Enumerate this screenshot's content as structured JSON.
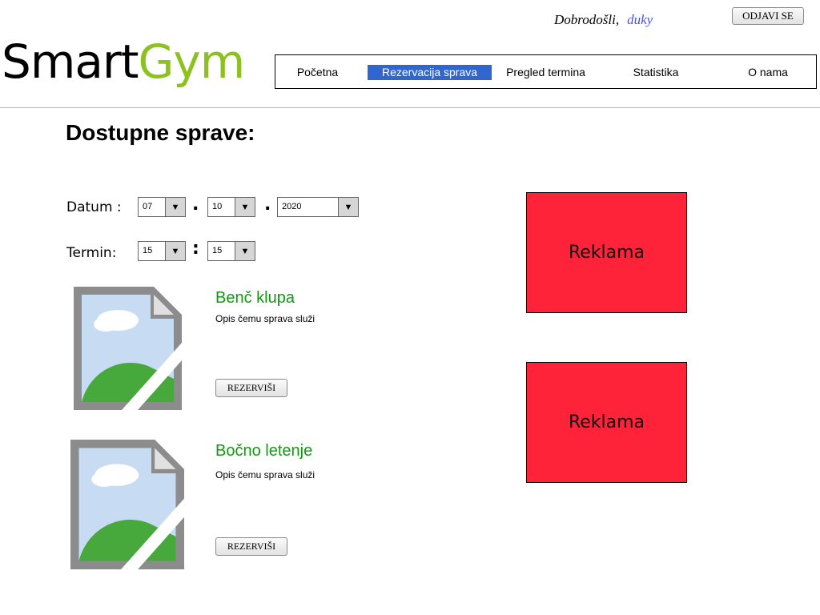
{
  "header": {
    "welcome_text": "Dobrodošli,",
    "username": "duky",
    "logout_label": "ODJAVI SE",
    "logo_part1": "Smart",
    "logo_part2": "Gym"
  },
  "nav": {
    "items": [
      {
        "label": "Početna",
        "active": false
      },
      {
        "label": "Rezervacija sprava",
        "active": true
      },
      {
        "label": "Pregled termina",
        "active": false
      },
      {
        "label": "Statistika",
        "active": false
      },
      {
        "label": "O nama",
        "active": false
      }
    ]
  },
  "main": {
    "title": "Dostupne sprave:",
    "date_label": "Datum :",
    "date_separator": ".",
    "day": "07",
    "month": "10",
    "year": "2020",
    "time_label": "Termin:",
    "time_separator": ":",
    "hour": "15",
    "minute": "15",
    "equipment": [
      {
        "name": "Benč klupa",
        "description": "Opis čemu sprava služi",
        "button": "REZERVIŠI"
      },
      {
        "name": "Bočno letenje",
        "description": "Opis čemu sprava služi",
        "button": "REZERVIŠI"
      }
    ]
  },
  "ads": [
    "Reklama",
    "Reklama"
  ],
  "colors": {
    "accent": "#2f66d0",
    "logo_green": "#8cc21f",
    "equipment_name": "#109a10",
    "ad_background": "#ff2339",
    "username": "#4a55d6"
  },
  "icons": {
    "dropdown": "triangle-down-icon",
    "equipment_image": "image-placeholder-icon"
  }
}
